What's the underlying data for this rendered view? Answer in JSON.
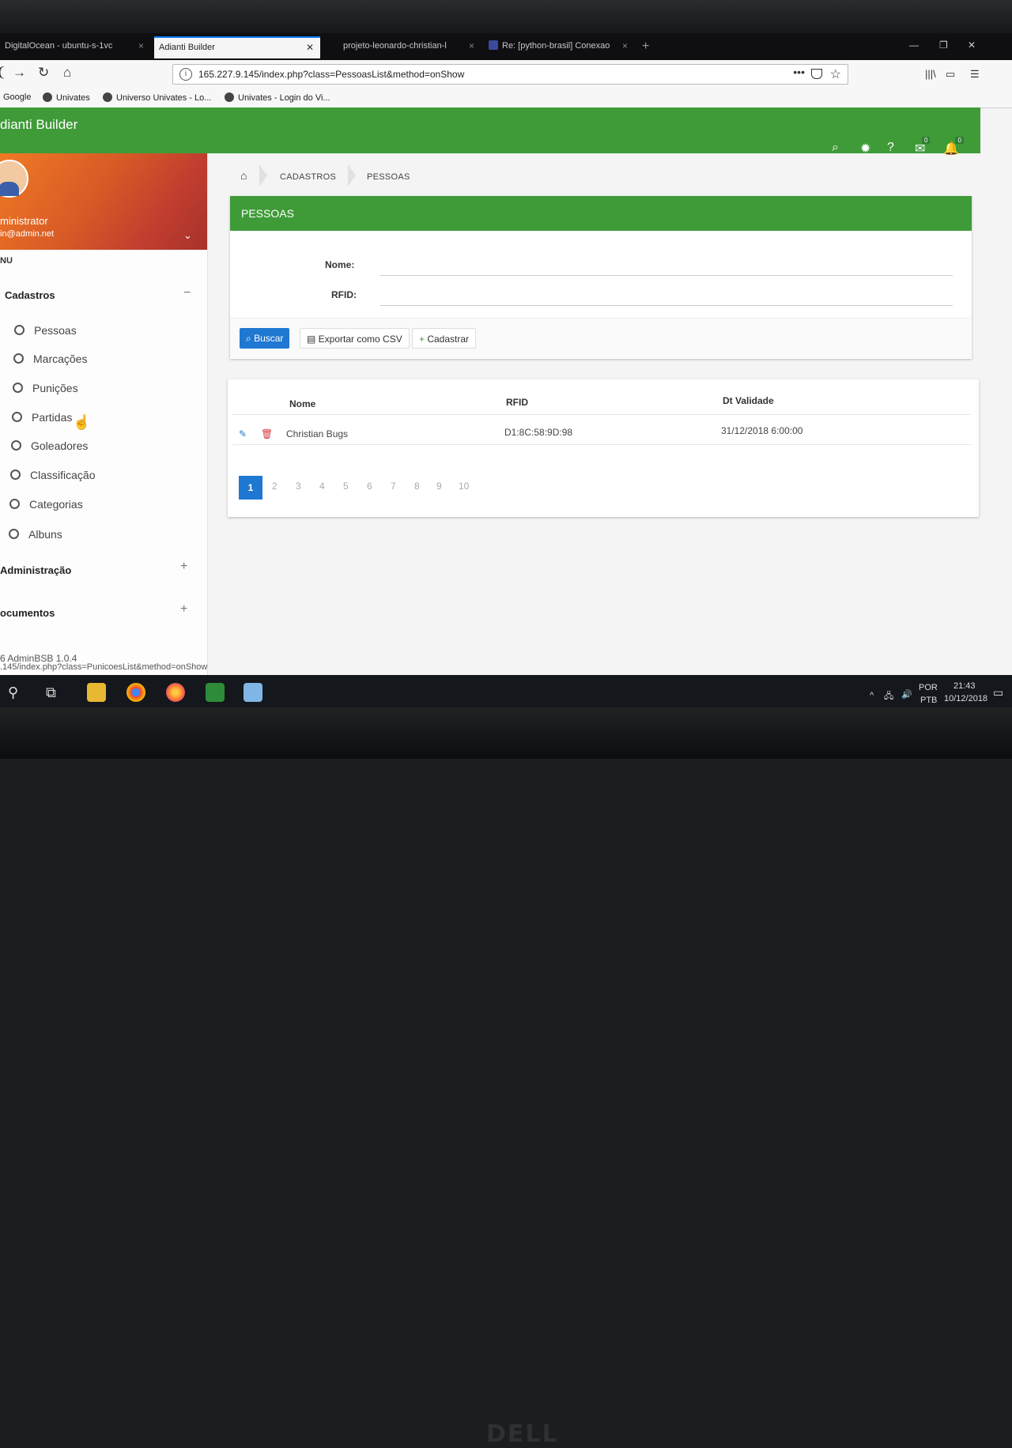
{
  "browser": {
    "tabs": [
      {
        "label": "DigitalOcean - ubuntu-s-1vc"
      },
      {
        "label": "Adianti Builder"
      },
      {
        "label": "projeto-leonardo-christian-l"
      },
      {
        "label": "Re: [python-brasil] Conexao"
      }
    ],
    "url": "165.227.9.145/index.php?class=PessoasList&method=onShow",
    "bookmarks": [
      "Google",
      "Univates",
      "Universo Univates - Lo...",
      "Univates - Login do Vi..."
    ]
  },
  "app": {
    "title": "dianti Builder",
    "header_badges": {
      "messages": "0",
      "notifications": "0"
    }
  },
  "sidebar": {
    "user_name": "ministrator",
    "user_email": "in@admin.net",
    "menu_header": "NU",
    "groups": [
      {
        "label": "Cadastros",
        "sign": "−",
        "items": [
          "Pessoas",
          "Marcações",
          "Punições",
          "Partidas",
          "Goleadores",
          "Classificação",
          "Categorias",
          "Albuns"
        ]
      },
      {
        "label": "Administração",
        "sign": "+"
      },
      {
        "label": "ocumentos",
        "sign": "+"
      }
    ],
    "footer": "6 AdminBSB 1.0.4"
  },
  "breadcrumb": [
    "CADASTROS",
    "PESSOAS"
  ],
  "form": {
    "title": "PESSOAS",
    "fields": [
      {
        "label": "Nome:",
        "value": ""
      },
      {
        "label": "RFID:",
        "value": ""
      }
    ],
    "buttons": {
      "search": "Buscar",
      "export": "Exportar como CSV",
      "create": "Cadastrar"
    }
  },
  "table": {
    "columns": [
      "Nome",
      "RFID",
      "Dt Validade"
    ],
    "rows": [
      {
        "nome": "Christian Bugs",
        "rfid": "D1:8C:58:9D:98",
        "validade": "31/12/2018 6:00:00"
      }
    ],
    "pages": [
      "1",
      "2",
      "3",
      "4",
      "5",
      "6",
      "7",
      "8",
      "9",
      "10"
    ],
    "active_page": "1"
  },
  "status_url": ".145/index.php?class=PunicoesList&method=onShow",
  "taskbar": {
    "lang": "POR",
    "layout": "PTB",
    "time": "21:43",
    "date": "10/12/2018"
  },
  "monitor_brand": "DELL",
  "colors": {
    "header_green": "#3f9b38",
    "primary_blue": "#1f78d1"
  }
}
